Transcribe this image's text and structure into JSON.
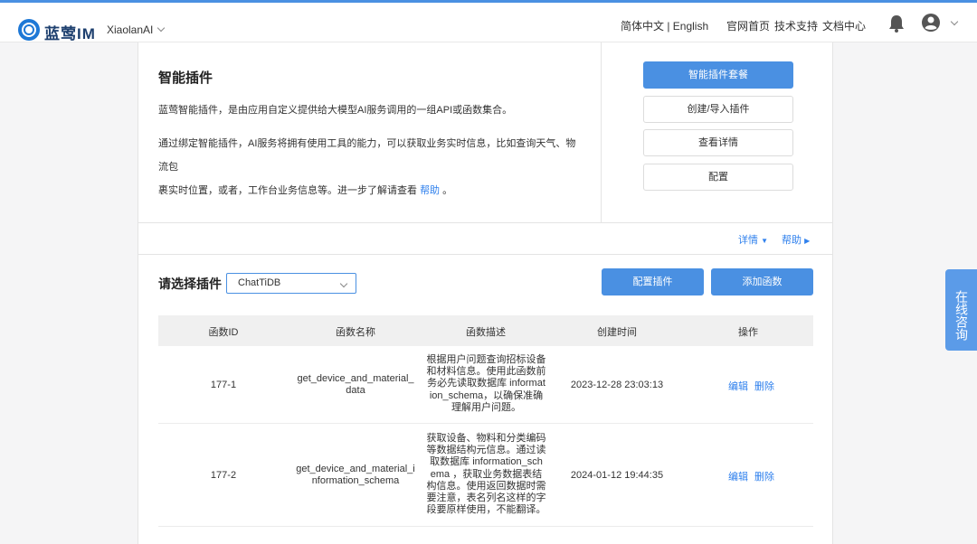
{
  "header": {
    "brand": "蓝莺IM",
    "user": "XiaolanAI",
    "lang": "简体中文 | English",
    "links": [
      "官网首页",
      "技术支持",
      "文档中心"
    ]
  },
  "intro": {
    "title": "智能插件",
    "para1": "蓝莺智能插件，是由应用自定义提供给大模型AI服务调用的一组API或函数集合。",
    "para2_line1": "通过绑定智能插件，AI服务将拥有使用工具的能力，可以获取业务实时信息，比如查询天气、物流包",
    "para2_line2": "裹实时位置，或者，工作台业务信息等。进一步了解请查看",
    "help_link": "帮助",
    "para2_end": "。"
  },
  "side_buttons": {
    "package": "智能插件套餐",
    "create": "创建/导入插件",
    "details": "查看详情",
    "config": "配置"
  },
  "subbar": {
    "detail": "详情",
    "help": "帮助"
  },
  "plugin_select": {
    "label": "请选择插件",
    "value": "ChatTiDB",
    "config_btn": "配置插件",
    "add_btn": "添加函数"
  },
  "table": {
    "headers": [
      "函数ID",
      "函数名称",
      "函数描述",
      "创建时间",
      "操作"
    ],
    "rows": [
      {
        "id": "177-1",
        "name_l1": "get_device_and_material_",
        "name_l2": "data",
        "desc": [
          "根据用户问题查询招标设备",
          "和材料信息。使用此函数前",
          "务必先读取数据库 informat",
          "ion_schema，以确保准确",
          "理解用户问题。"
        ],
        "time": "2023-12-28 23:03:13",
        "edit": "编辑",
        "delete": "删除"
      },
      {
        "id": "177-2",
        "name_l1": "get_device_and_material_i",
        "name_l2": "nformation_schema",
        "desc": [
          "获取设备、物料和分类编码",
          "等数据结构元信息。通过读",
          "取数据库 information_sch",
          "ema ，获取业务数据表结",
          "构信息。使用返回数据时需",
          "要注意，表名列名这样的字",
          "段要原样使用，不能翻译。"
        ],
        "time": "2024-01-12 19:44:35",
        "edit": "编辑",
        "delete": "删除"
      }
    ]
  },
  "consult": "在线咨询",
  "colors": {
    "primary": "#4a90e2",
    "link": "#2f80ed"
  }
}
